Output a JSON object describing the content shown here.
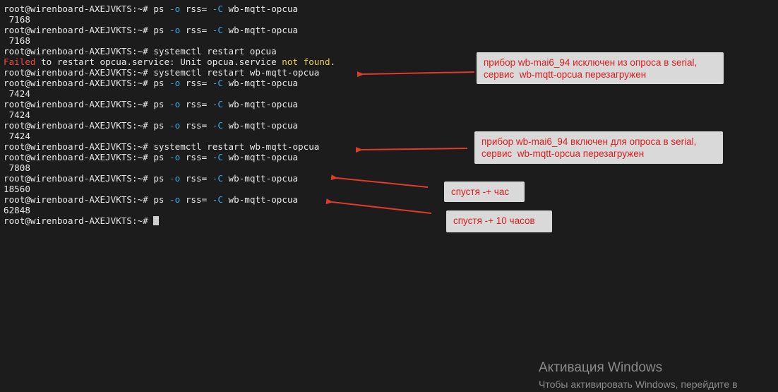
{
  "terminal": {
    "prompt": "root@wirenboard-AXEJVKTS:~# ",
    "lines": [
      {
        "kind": "ps",
        "cmd": "ps",
        "opt1": "-o",
        "mid": "rss=",
        "opt2": "-C",
        "arg": "wb-mqtt-opcua"
      },
      {
        "kind": "out",
        "text": " 7168"
      },
      {
        "kind": "ps",
        "cmd": "ps",
        "opt1": "-o",
        "mid": "rss=",
        "opt2": "-C",
        "arg": "wb-mqtt-opcua"
      },
      {
        "kind": "out",
        "text": " 7168"
      },
      {
        "kind": "cmd",
        "text": "systemctl restart opcua"
      },
      {
        "kind": "error",
        "failed": "Failed",
        "middle": " to restart opcua.service: Unit opcua.service ",
        "notfound": "not found",
        "end": "."
      },
      {
        "kind": "cmd",
        "text": "systemctl restart wb-mqtt-opcua"
      },
      {
        "kind": "ps",
        "cmd": "ps",
        "opt1": "-o",
        "mid": "rss=",
        "opt2": "-C",
        "arg": "wb-mqtt-opcua"
      },
      {
        "kind": "out",
        "text": " 7424"
      },
      {
        "kind": "ps",
        "cmd": "ps",
        "opt1": "-o",
        "mid": "rss=",
        "opt2": "-C",
        "arg": "wb-mqtt-opcua"
      },
      {
        "kind": "out",
        "text": " 7424"
      },
      {
        "kind": "ps",
        "cmd": "ps",
        "opt1": "-o",
        "mid": "rss=",
        "opt2": "-C",
        "arg": "wb-mqtt-opcua"
      },
      {
        "kind": "out",
        "text": " 7424"
      },
      {
        "kind": "cmd",
        "text": "systemctl restart wb-mqtt-opcua"
      },
      {
        "kind": "ps",
        "cmd": "ps",
        "opt1": "-o",
        "mid": "rss=",
        "opt2": "-C",
        "arg": "wb-mqtt-opcua"
      },
      {
        "kind": "out",
        "text": " 7808"
      },
      {
        "kind": "ps",
        "cmd": "ps",
        "opt1": "-o",
        "mid": "rss=",
        "opt2": "-C",
        "arg": "wb-mqtt-opcua"
      },
      {
        "kind": "out",
        "text": "18560"
      },
      {
        "kind": "ps",
        "cmd": "ps",
        "opt1": "-o",
        "mid": "rss=",
        "opt2": "-C",
        "arg": "wb-mqtt-opcua"
      },
      {
        "kind": "out",
        "text": "62848"
      },
      {
        "kind": "cursor"
      }
    ]
  },
  "annotations": [
    {
      "id": "note-excluded",
      "text": "прибор wb-mai6_94 исключен из опроса в serial,\nсервис  wb-mqtt-opcua перезагружен"
    },
    {
      "id": "note-included",
      "text": "прибор wb-mai6_94 включен для опроса в serial,\nсервис  wb-mqtt-opcua перезагружен"
    },
    {
      "id": "note-hour",
      "text": "спустя -+ час"
    },
    {
      "id": "note-10h",
      "text": "спустя -+ 10 часов"
    }
  ],
  "colors": {
    "background": "#1c1c1c",
    "text": "#e8e8e8",
    "option": "#3aa6e0",
    "error": "#e84a3a",
    "warning": "#e8d34a",
    "annotation_bg": "#d9d9d9",
    "annotation_text": "#e01e1e",
    "arrow": "#e03a2a"
  },
  "watermark": {
    "title": "Активация Windows",
    "subtitle": "Чтобы активировать Windows, перейдите в"
  }
}
